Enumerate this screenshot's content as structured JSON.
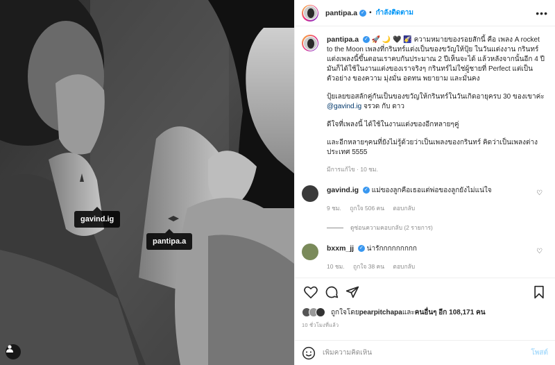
{
  "post": {
    "username": "pantipa.a",
    "follow_status": "กำลังติดตาม",
    "more_label": "•••",
    "caption_emojis": "🚀 🌙 🖤 🌠",
    "caption_p1": "ความหมายของรอยสักนี้ คือ เพลง A rocket to the Moon เพลงที่กรินทร์แต่งเป็นของขวัญให้ปุ้ย ในวันแต่งงาน กรินทร์แต่งเพลงนี้ขึ้นตอนเราคบกันประมาณ 2 ปีเห็นจะได้ แล้วหลังจากนั้นอีก 4 ปี มันก็ได้ใช้ในงานแต่งของเราจริงๆ กรินทร์ไม่ใช่ผู้ชายที่ Perfect แต่เป็นตัวอย่าง ของความ มุ่งมั่น อดทน พยายาม และมั่นคง",
    "caption_p2_a": "ปุ้ยเลยขอสลักคู่กันเป็นของขวัญให้กรินทร์ในวันเกิดอายุครบ 30 ของเขาค่ะ ",
    "caption_p2_link": "@gavind.ig",
    "caption_p2_b": " จรวด กับ ดาว",
    "caption_p3": "ดีใจที่เพลงนี้ ได้ใช้ในงานแต่งของอีกหลายๆคู่",
    "caption_p4": "และอีกหลายๆคนที่ยังไม่รู้ด้วยว่าเป็นเพลงของกรินทร์ คิดว่าเป็นเพลงต่างประเทศ 5555",
    "caption_meta": "มีการแก้ไข · 10 ชม."
  },
  "photo_tags": [
    {
      "label": "gavind.ig"
    },
    {
      "label": "pantipa.a"
    }
  ],
  "comments": [
    {
      "username": "gavind.ig",
      "verified": true,
      "text": "แม่ของลูกคือเธอแต่พ่อของลูกยังไม่แน่ใจ",
      "time": "9 ชม.",
      "likes": "ถูกใจ 506 คน",
      "reply": "ตอบกลับ",
      "view_replies": "ดูซ่อนความคอบกลับ (2 รายการ)",
      "avatar_color": "#3a3a3a"
    },
    {
      "username": "bxxm_jj",
      "verified": true,
      "text": "น่ารักกกกกกกกก",
      "time": "10 ชม.",
      "likes": "ถูกใจ 38 คน",
      "reply": "ตอบกลับ",
      "avatar_color": "#7a8a5a"
    }
  ],
  "likes": {
    "prefix": "ถูกใจโดย ",
    "first_user": "pearpitchapa",
    "middle": " และ ",
    "others": "คนอื่นๆ อีก 108,171 คน"
  },
  "timestamp": "10 ชั่วโมงที่แล้ว",
  "add_comment": {
    "placeholder": "เพิ่มความคิดเห็น",
    "post_label": "โพสต์"
  },
  "icons": {
    "like": "heart-icon",
    "comment": "comment-icon",
    "share": "share-icon",
    "save": "bookmark-icon",
    "emoji": "emoji-icon",
    "tagged": "person-icon"
  },
  "colors": {
    "link": "#0095f6",
    "verified": "#3897f0",
    "muted": "#8e8e8e",
    "border": "#efefef"
  }
}
